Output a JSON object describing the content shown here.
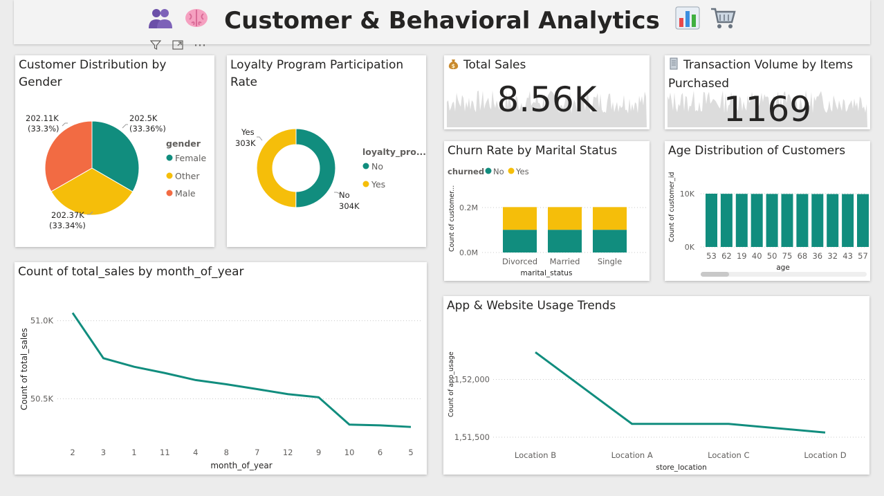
{
  "header": {
    "title": "Customer & Behavioral Analytics",
    "left_icons": [
      "people-icon",
      "brain-icon"
    ],
    "right_icons": [
      "bar-chart-icon",
      "cart-icon"
    ]
  },
  "toolbar": {
    "filter_icon": "filter-icon",
    "focus_icon": "focus-mode-icon",
    "more_label": "⋯"
  },
  "gender_card": {
    "title": "Customer Distribution by Gender",
    "legend_title": "gender",
    "colors": {
      "Female": "#118D7E",
      "Other": "#F5BE0A",
      "Male": "#F26B43"
    },
    "chart_data": {
      "type": "pie",
      "categories": [
        "Female",
        "Other",
        "Male"
      ],
      "values": [
        202500,
        202370,
        202110
      ],
      "labels": [
        "202.5K",
        "202.37K",
        "202.11K"
      ],
      "percents": [
        "(33.36%)",
        "(33.34%)",
        "(33.3%)"
      ]
    }
  },
  "loyalty_card": {
    "title": "Loyalty Program Participation Rate",
    "legend_title": "loyalty_pro...",
    "colors": {
      "No": "#118D7E",
      "Yes": "#F5BE0A"
    },
    "chart_data": {
      "type": "pie",
      "donut": true,
      "categories": [
        "No",
        "Yes"
      ],
      "values": [
        304000,
        303000
      ],
      "labels": [
        "304K",
        "303K"
      ]
    }
  },
  "sales_kpi": {
    "title": "Total Sales",
    "icon": "money-bag-icon",
    "value": "8.56K"
  },
  "transaction_kpi": {
    "title": "Transaction Volume by Items Purchased",
    "icon": "receipt-icon",
    "value": "1169"
  },
  "churn_card": {
    "title": "Churn Rate by Marital Status",
    "legend_title": "churned",
    "legend_items": [
      "No",
      "Yes"
    ],
    "colors": {
      "No": "#118D7E",
      "Yes": "#F5BE0A"
    },
    "chart_data": {
      "type": "bar",
      "stacked": true,
      "categories": [
        "Divorced",
        "Married",
        "Single"
      ],
      "series": [
        {
          "name": "No",
          "values": [
            0.101,
            0.101,
            0.101
          ]
        },
        {
          "name": "Yes",
          "values": [
            0.101,
            0.101,
            0.101
          ]
        }
      ],
      "xlabel": "marital_status",
      "ylabel": "Count of customer...",
      "yticks": [
        "0.0M",
        "0.2M"
      ],
      "ylim": [
        0,
        0.2
      ]
    }
  },
  "age_card": {
    "title": "Age Distribution of Customers",
    "color": "#118D7E",
    "chart_data": {
      "type": "bar",
      "categories": [
        "53",
        "62",
        "19",
        "40",
        "50",
        "75",
        "68",
        "36",
        "32",
        "43",
        "57"
      ],
      "values": [
        10000,
        9980,
        9970,
        9960,
        9955,
        9950,
        9945,
        9940,
        9935,
        9930,
        9925
      ],
      "xlabel": "age",
      "ylabel": "Count of customer_id",
      "yticks": [
        "0K",
        "10K"
      ],
      "ylim": [
        0,
        10000
      ]
    }
  },
  "month_card": {
    "title": "Count of total_sales by month_of_year",
    "color": "#118D7E",
    "chart_data": {
      "type": "line",
      "x": [
        "2",
        "3",
        "1",
        "11",
        "4",
        "8",
        "7",
        "12",
        "9",
        "10",
        "6",
        "5"
      ],
      "values": [
        51050,
        50760,
        50705,
        50665,
        50620,
        50593,
        50562,
        50530,
        50510,
        50335,
        50330,
        50320
      ],
      "xlabel": "month_of_year",
      "ylabel": "Count of total_sales",
      "yticks": [
        "50.5K",
        "51.0K"
      ],
      "ytick_values": [
        50500,
        51000
      ],
      "ylim": [
        50250,
        51100
      ]
    }
  },
  "app_card": {
    "title": "App & Website Usage Trends",
    "color": "#118D7E",
    "chart_data": {
      "type": "line",
      "x": [
        "Location B",
        "Location A",
        "Location C",
        "Location D"
      ],
      "values": [
        152235,
        151615,
        151615,
        151540
      ],
      "xlabel": "store_location",
      "ylabel": "Count of app_usage",
      "yticks": [
        "1,51,500",
        "1,52,000"
      ],
      "ytick_values": [
        151500,
        152000
      ],
      "ylim": [
        151380,
        152350
      ]
    }
  }
}
